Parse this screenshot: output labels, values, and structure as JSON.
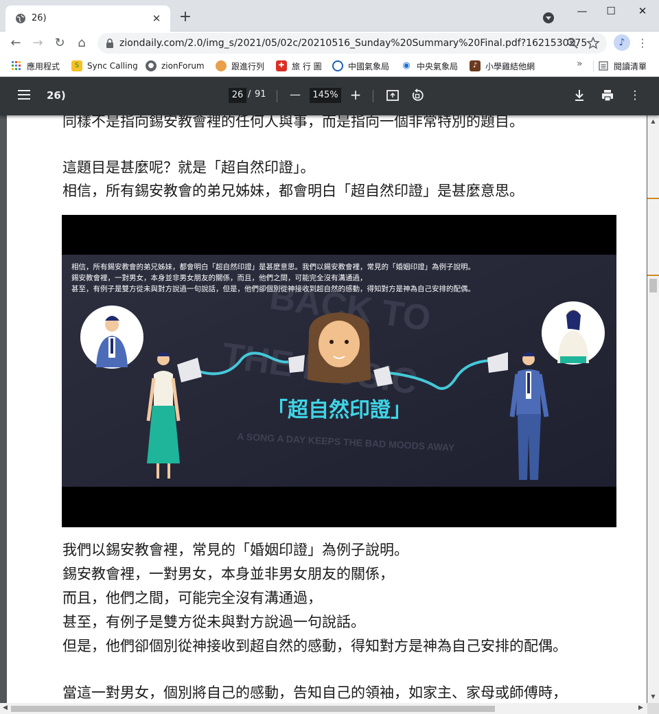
{
  "browser": {
    "tab_title": "26)",
    "tab_close": "✕",
    "new_tab": "+",
    "window": {
      "minimize": "—",
      "maximize": "☐",
      "close": "✕"
    },
    "nav": {
      "back": "←",
      "forward": "→",
      "reload": "↻",
      "home": "⌂"
    },
    "url": "ziondaily.com/2.0/img_s/2021/05/02c/20210516_Sunday%20Summary%20Final.pdf?1621530275",
    "avatar_letter": "♪",
    "menu": "⋮"
  },
  "bookmarks": {
    "items": [
      {
        "label": "應用程式",
        "icon": "apps-grid-icon",
        "color": "#4285f4"
      },
      {
        "label": "Sync Calling",
        "icon": "sync-calling-icon",
        "color": "#f6c026"
      },
      {
        "label": "zionForum",
        "icon": "globe-icon",
        "color": "#5f6368"
      },
      {
        "label": "跟進行列",
        "icon": "cookie-icon",
        "color": "#e8a04a"
      },
      {
        "label": "旅 行 圖",
        "icon": "travel-icon",
        "color": "#d93025"
      },
      {
        "label": "中國氣象局",
        "icon": "weather-cn-icon",
        "color": "#1a5fb4"
      },
      {
        "label": "中央氣象局",
        "icon": "weather-tw-icon",
        "color": "#1e6fd9"
      },
      {
        "label": "小學雞結他網",
        "icon": "guitar-icon",
        "color": "#6b3a1e"
      }
    ],
    "more": "»",
    "reading_list": "閱讀清單"
  },
  "pdf": {
    "title": "26)",
    "page_current": "26",
    "page_sep": "/",
    "page_total": "91",
    "zoom": "145%",
    "zoom_out": "—",
    "zoom_in": "+"
  },
  "content": {
    "line_top": "同樣不是指向錫安教會裡的任何人與事，而是指向一個非常特別的題目。",
    "para1_line1": "這題目是甚麼呢？就是「超自然印證」。",
    "para1_line2": "相信，所有錫安教會的弟兄姊妹，都會明白「超自然印證」是甚麼意思。",
    "figure": {
      "caption_line1": "相信，所有錫安教會的弟兄姊妹，都會明白「超自然印證」是甚麼意思。我們以錫安教會裡，常見的「婚姻印證」為例子說明。",
      "caption_line2": "錫安教會裡，一對男女，本身並非男女朋友的關係，而且，他們之間，可能完全沒有溝通過，",
      "caption_line3": "甚至，有例子是雙方從未與對方說過一句說話，但是，他們卻個別從神接收到超自然的感動，得知對方是神為自己安排的配偶。",
      "title": "「超自然印證」",
      "bg_text_1": "BACK TO",
      "bg_text_2": "THE MUSIC",
      "bg_text_3": "A SONG A DAY KEEPS THE BAD MOODS AWAY"
    },
    "para2": [
      "我們以錫安教會裡，常見的「婚姻印證」為例子說明。",
      "錫安教會裡，一對男女，本身並非男女朋友的關係，",
      "而且，他們之間，可能完全沒有溝通過，",
      "甚至，有例子是雙方從未與對方說過一句說話。",
      "但是，他們卻個別從神接收到超自然的感動，得知對方是神為自己安排的配偶。"
    ],
    "para3_line1": "當這一對男女，個別將自己的感動，告知自己的領袖，如家主、家母或師傅時，"
  }
}
